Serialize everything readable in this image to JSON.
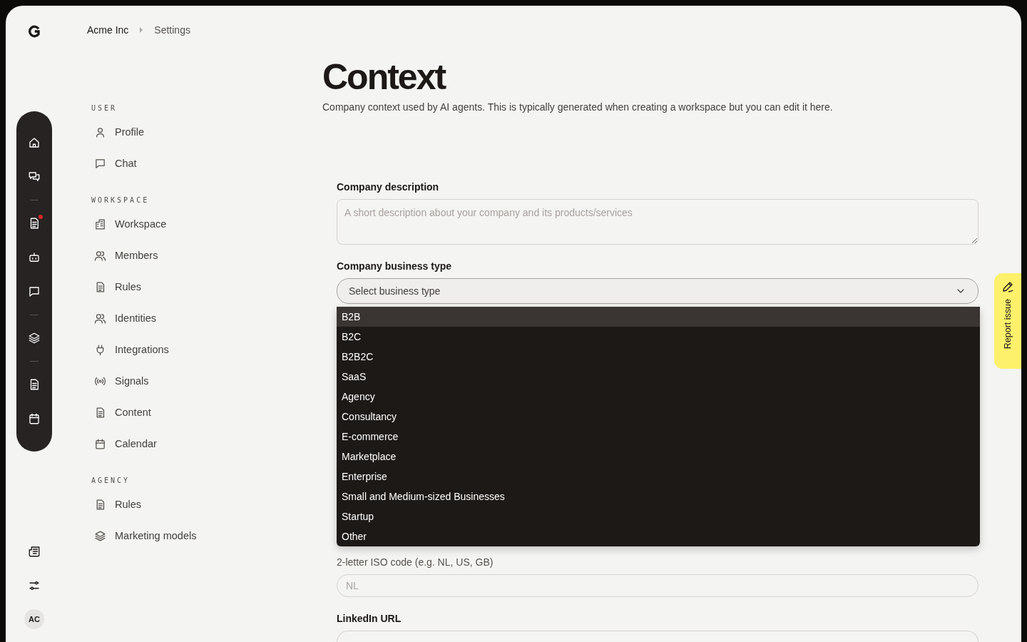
{
  "breadcrumb": [
    "Acme Inc",
    "Settings"
  ],
  "rail": {
    "groups": [
      [
        {
          "notification": false
        },
        {
          "notification": false
        }
      ],
      [
        {
          "notification": true
        },
        {
          "notification": false
        },
        {
          "notification": false
        }
      ],
      [
        {
          "notification": false
        }
      ],
      [
        {
          "notification": false
        },
        {
          "notification": false
        }
      ]
    ],
    "avatar": "AC"
  },
  "sidebar": {
    "sections": [
      {
        "title": "USER",
        "items": [
          "Profile",
          "Chat"
        ]
      },
      {
        "title": "WORKSPACE",
        "items": [
          "Workspace",
          "Members",
          "Rules",
          "Identities",
          "Integrations",
          "Signals",
          "Content",
          "Calendar"
        ]
      },
      {
        "title": "AGENCY",
        "items": [
          "Rules",
          "Marketing models"
        ]
      }
    ]
  },
  "page": {
    "title": "Context",
    "subtitle": "Company context used by AI agents. This is typically generated when creating a workspace but you can edit it here."
  },
  "form": {
    "description": {
      "label": "Company description",
      "placeholder": "A short description about your company and its products/services"
    },
    "business_type": {
      "label": "Company business type",
      "placeholder": "Select business type",
      "expanded": true,
      "options": [
        {
          "label": "B2B",
          "selected": true
        },
        {
          "label": "B2C",
          "selected": false
        },
        {
          "label": "B2B2C",
          "selected": false
        },
        {
          "label": "SaaS",
          "selected": false
        },
        {
          "label": "Agency",
          "selected": false
        },
        {
          "label": "Consultancy",
          "selected": false
        },
        {
          "label": "E-commerce",
          "selected": false
        },
        {
          "label": "Marketplace",
          "selected": false
        },
        {
          "label": "Enterprise",
          "selected": false
        },
        {
          "label": "Small and Medium-sized Businesses",
          "selected": false
        },
        {
          "label": "Startup",
          "selected": false
        },
        {
          "label": "Other",
          "selected": false
        }
      ]
    },
    "country": {
      "hint": "2-letter ISO code (e.g. NL, US, GB)",
      "placeholder": "NL"
    },
    "linkedin": {
      "label": "LinkedIn URL"
    }
  },
  "report_button": "Report issue"
}
